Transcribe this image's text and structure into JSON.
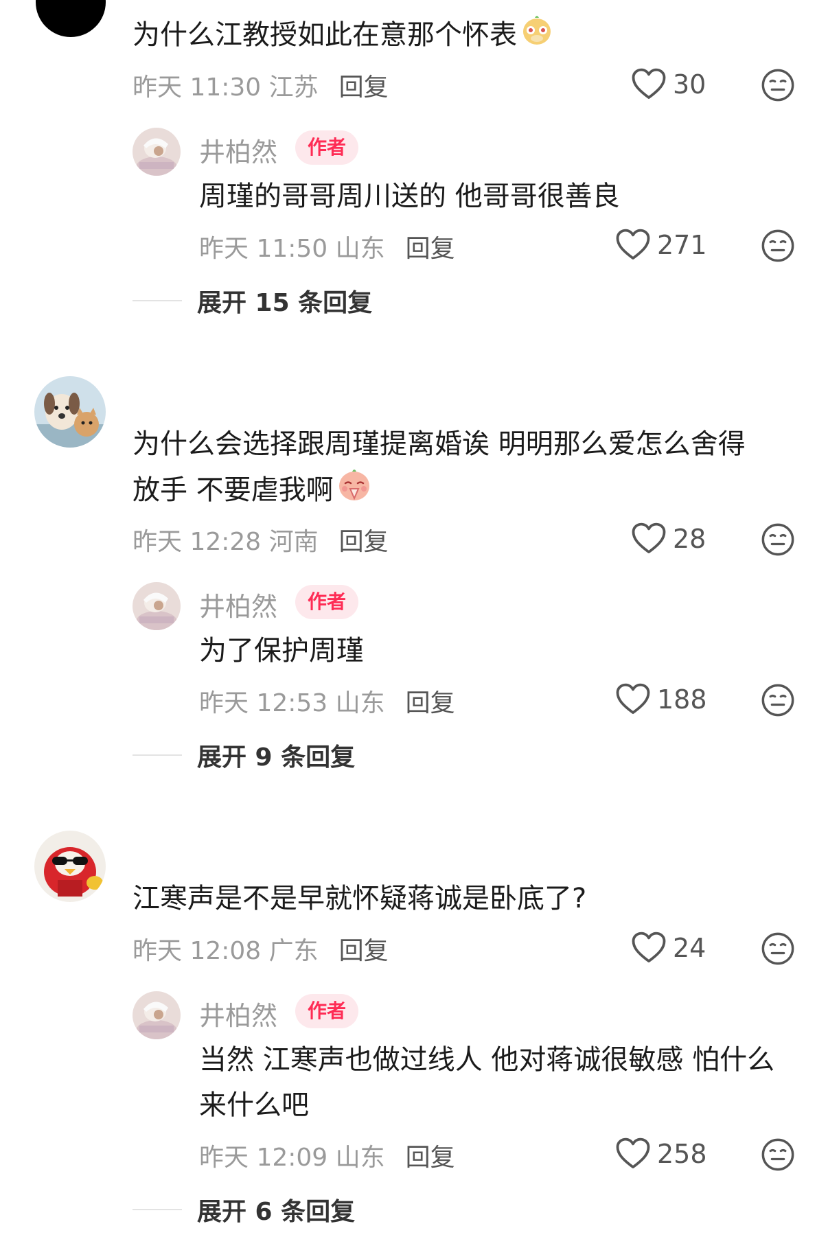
{
  "comments": [
    {
      "text_lines": [
        "为什么江教授如此在意那个怀表"
      ],
      "emoji": "meerkat-emoji",
      "time": "昨天 11:30 江苏",
      "reply_label": "回复",
      "likes": "30",
      "author_reply": {
        "username": "井柏然",
        "badge": "作者",
        "text_lines": [
          "周瑾的哥哥周川送的 他哥哥很善良"
        ],
        "time": "昨天 11:50 山东",
        "reply_label": "回复",
        "likes": "271"
      },
      "expand_label": "展开 15 条回复"
    },
    {
      "text_lines": [
        "为什么会选择跟周瑾提离婚诶 明明那么爱怎么舍得",
        "放手 不要虐我啊"
      ],
      "emoji": "praying-emoji",
      "time": "昨天 12:28 河南",
      "reply_label": "回复",
      "likes": "28",
      "author_reply": {
        "username": "井柏然",
        "badge": "作者",
        "text_lines": [
          "为了保护周瑾"
        ],
        "time": "昨天 12:53 山东",
        "reply_label": "回复",
        "likes": "188"
      },
      "expand_label": "展开 9 条回复"
    },
    {
      "text_lines": [
        "江寒声是不是早就怀疑蒋诚是卧底了?"
      ],
      "time": "昨天 12:08 广东",
      "reply_label": "回复",
      "likes": "24",
      "author_reply": {
        "username": "井柏然",
        "badge": "作者",
        "text_lines": [
          "当然 江寒声也做过线人 他对蒋诚很敏感 怕什么",
          "来什么吧"
        ],
        "time": "昨天 12:09 山东",
        "reply_label": "回复",
        "likes": "258"
      },
      "expand_label": "展开 6 条回复"
    }
  ],
  "colors": {
    "accent": "#fe2c55",
    "badge_bg": "#fde8ec",
    "meta": "#9a9a9a"
  },
  "icons": {
    "like": "heart-outline-icon",
    "dislike": "meh-face-icon"
  }
}
